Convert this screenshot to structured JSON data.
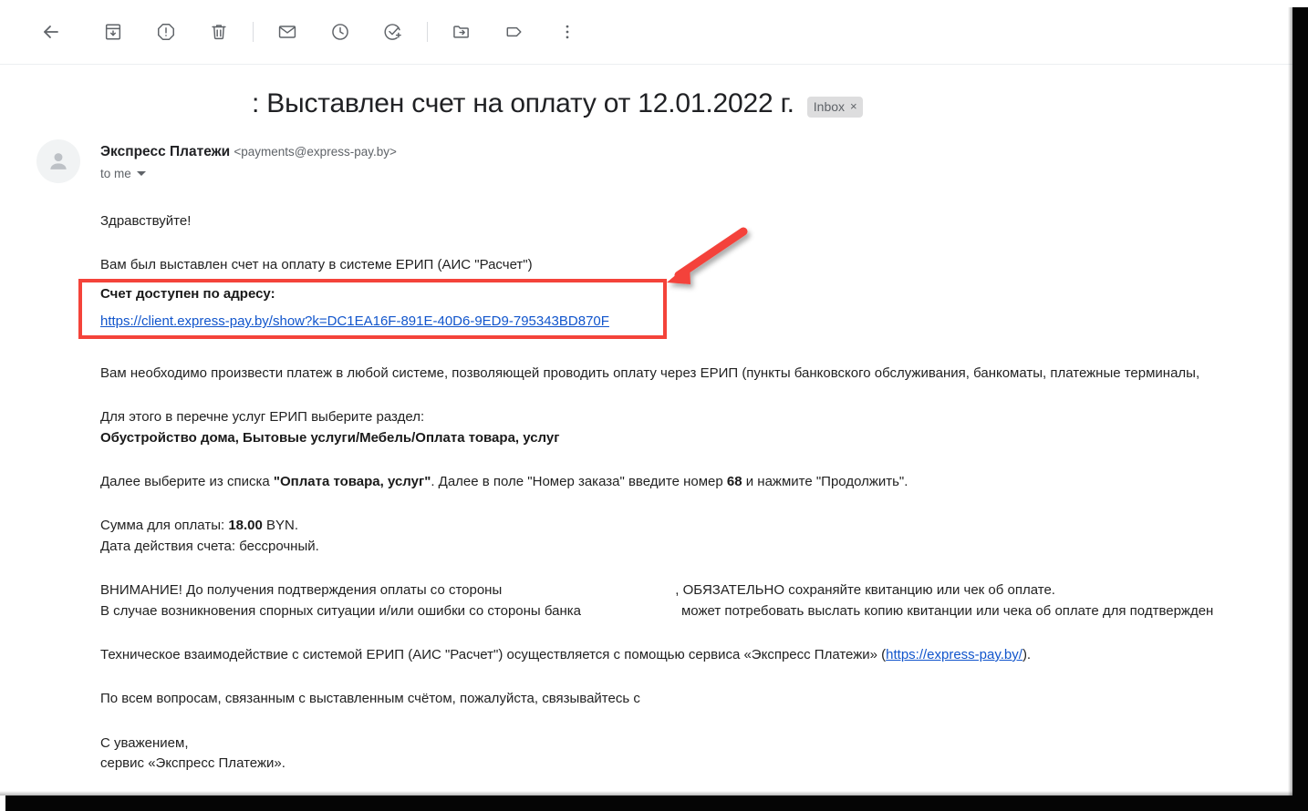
{
  "toolbar": {
    "buttons": [
      {
        "name": "back-button",
        "label": "Back",
        "icon": "arrow-left-icon"
      },
      {
        "name": "archive-button",
        "label": "Archive",
        "icon": "archive-icon"
      },
      {
        "name": "report-spam-button",
        "label": "Report spam",
        "icon": "report-spam-icon"
      },
      {
        "name": "delete-button",
        "label": "Delete",
        "icon": "trash-icon"
      },
      {
        "name": "mark-unread-button",
        "label": "Mark as unread",
        "icon": "envelope-icon"
      },
      {
        "name": "snooze-button",
        "label": "Snooze",
        "icon": "clock-icon"
      },
      {
        "name": "add-to-tasks-button",
        "label": "Add to tasks",
        "icon": "task-check-icon"
      },
      {
        "name": "move-to-button",
        "label": "Move to",
        "icon": "folder-move-icon"
      },
      {
        "name": "labels-button",
        "label": "Labels",
        "icon": "label-tag-icon"
      },
      {
        "name": "more-button",
        "label": "More",
        "icon": "more-vertical-icon"
      }
    ]
  },
  "subject": {
    "text": ": Выставлен счет на оплату от 12.01.2022 г.",
    "chip_label": "Inbox",
    "chip_remove": "×"
  },
  "sender": {
    "name": "Экспресс Платежи",
    "email": "<payments@express-pay.by>",
    "recipient": "to me"
  },
  "email_body": {
    "greeting": "Здравствуйте!",
    "intro": "Вам был выставлен счет на оплату в системе ЕРИП (АИС \"Расчет\")",
    "invoice_box": {
      "title": "Счет доступен по адресу:",
      "link_text": "https://client.express-pay.by/show?k=DC1EA16F-891E-40D6-9ED9-795343BD870F",
      "link_href": "https://client.express-pay.by/show?k=DC1EA16F-891E-40D6-9ED9-795343BD870F"
    },
    "payment_note": "Вам необходимо произвести платеж в любой системе, позволяющей проводить оплату через ЕРИП (пункты банковского обслуживания, банкоматы, платежные терминалы,",
    "erip_path_intro": "Для этого в перечне услуг ЕРИП выберите раздел:",
    "erip_path": "Обустройство дома, Бытовые услуги/Мебель/Оплата товара, услуг",
    "order_line_part1": "Далее выберите из списка ",
    "order_line_quoted": "\"Оплата товара, услуг\"",
    "order_line_part2": ". Далее в поле \"Номер заказа\" введите номер ",
    "order_number": "68",
    "order_line_part3": " и нажмите \"Продолжить\".",
    "amount_label": "Сумма для оплаты: ",
    "amount_value": "18.00",
    "amount_currency": " BYN.",
    "validity_line": "Дата действия счета: бессрочный.",
    "warning_part1": "ВНИМАНИЕ! До получения подтверждения оплаты со стороны",
    "warning_part2": ", ОБЯЗАТЕЛЬНО сохраняйте квитанцию или чек об оплате.",
    "dispute_part1": "В случае возникновения спорных ситуации и/или ошибки со стороны банка",
    "dispute_part2": "может потребовать выслать копию квитанции или чека об оплате для подтвержден",
    "tech_part1": "Техническое взаимодействие с системой ЕРИП (АИС \"Расчет\") осуществляется с помощью сервиса «Экспресс Платежи» (",
    "tech_link_text": "https://express-pay.by/",
    "tech_link_href": "https://express-pay.by/",
    "tech_part2": ").",
    "contact_line": "По всем вопросам, связанным с выставленным счётом, пожалуйста, связывайтесь с",
    "signature_line1": "С уважением,",
    "signature_line2": "сервис «Экспресс Платежи»."
  },
  "annotations": {
    "highlight_color": "#f4433a",
    "arrow_name": "red-arrow-annotation",
    "box_name": "red-highlight-box"
  },
  "colors": {
    "link": "#1155cc",
    "text": "#222222",
    "muted": "#5f6368",
    "chip_bg": "#ddddde"
  }
}
